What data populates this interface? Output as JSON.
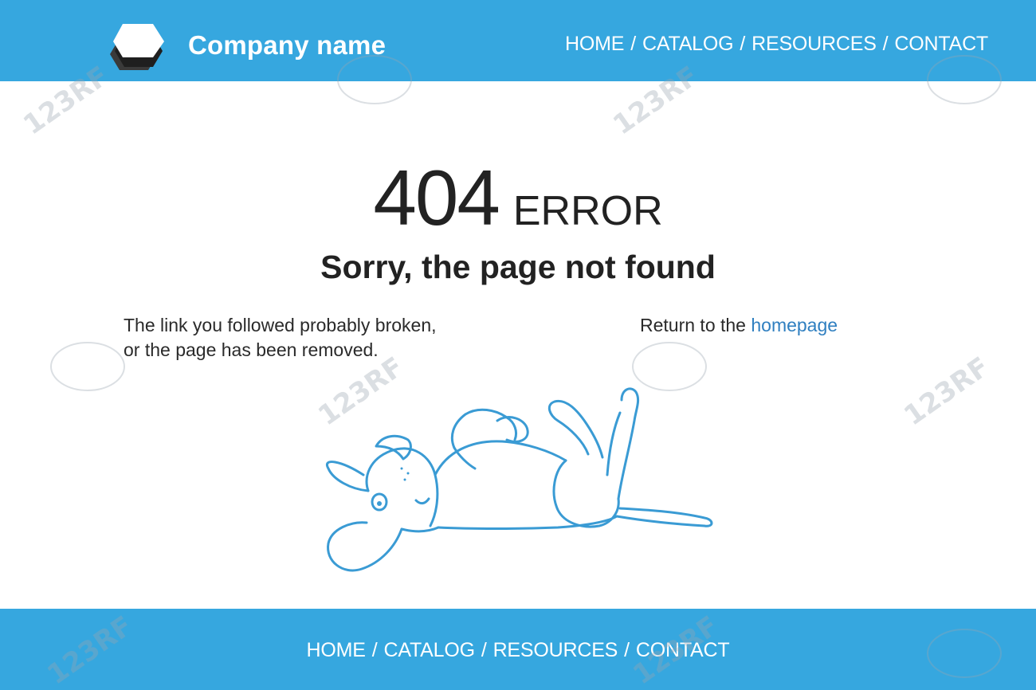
{
  "header": {
    "brand": "Company name",
    "logo_icon": "hexagon-logo-icon",
    "nav": [
      {
        "label": "HOME"
      },
      {
        "label": "CATALOG"
      },
      {
        "label": "RESOURCES"
      },
      {
        "label": "CONTACT"
      }
    ],
    "separator": "/"
  },
  "main": {
    "code": "404",
    "code_word": "ERROR",
    "title": "Sorry, the page not found",
    "message_line1": "The link you followed probably broken,",
    "message_line2": "or the page has been removed.",
    "return_prefix": "Return to the",
    "return_link": "homepage",
    "illustration": "dog-lying-on-back-illustration"
  },
  "footer": {
    "nav": [
      {
        "label": "HOME"
      },
      {
        "label": "CATALOG"
      },
      {
        "label": "RESOURCES"
      },
      {
        "label": "CONTACT"
      }
    ],
    "separator": "/"
  },
  "watermark": "123RF",
  "colors": {
    "accent": "#36a7df",
    "link": "#2f7fc0",
    "text": "#222222",
    "illustration_stroke": "#3a9bd4"
  }
}
